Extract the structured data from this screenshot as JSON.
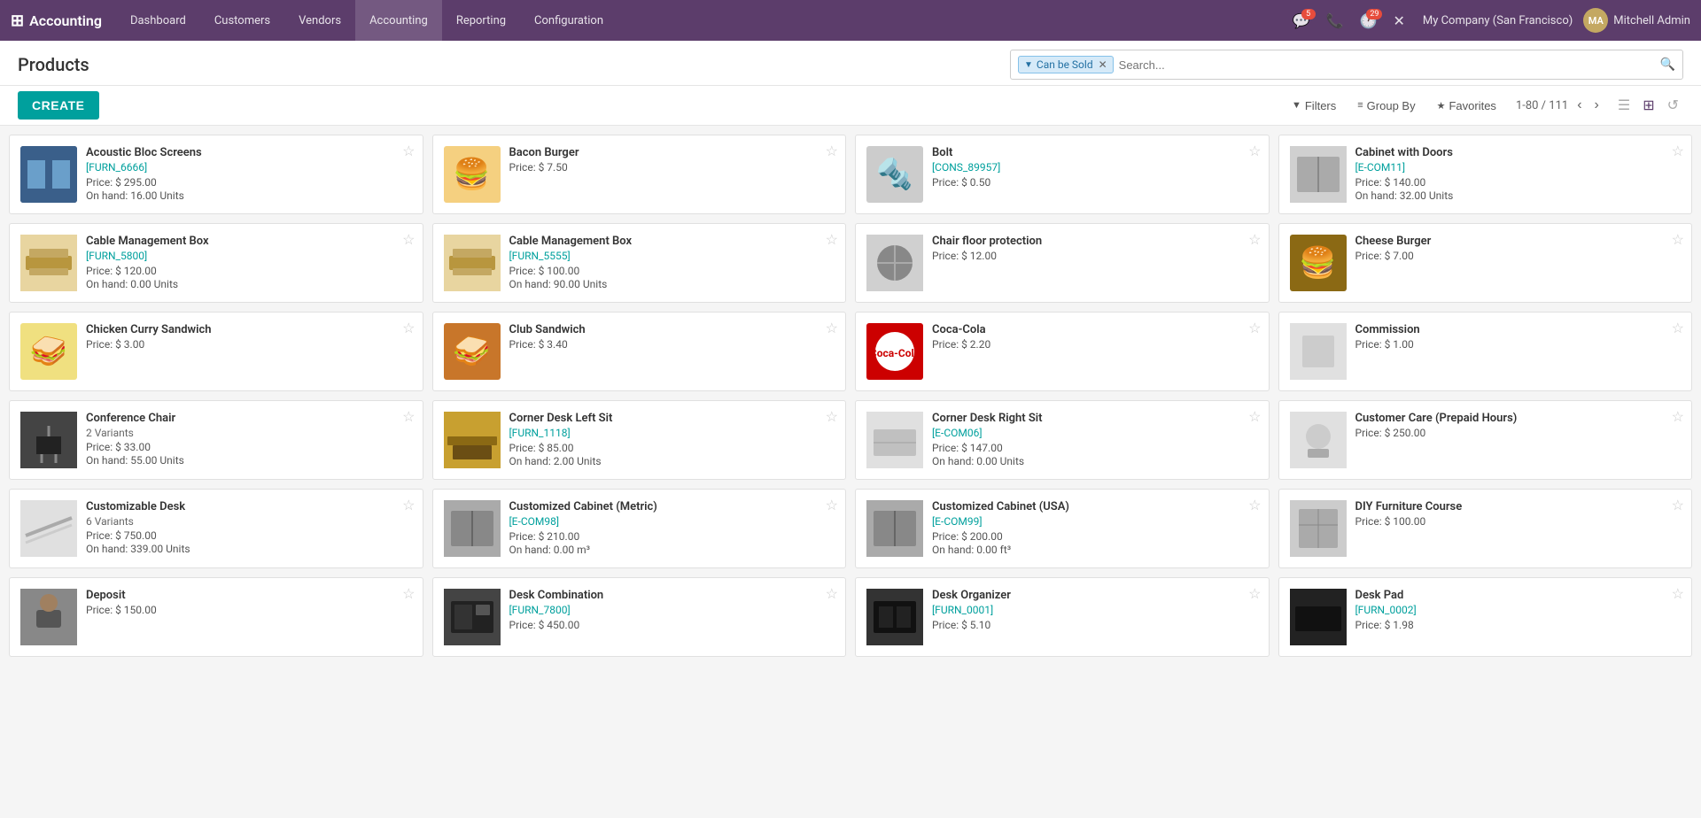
{
  "app": {
    "name": "Accounting"
  },
  "topnav": {
    "menu_items": [
      {
        "label": "Dashboard",
        "active": false
      },
      {
        "label": "Customers",
        "active": false
      },
      {
        "label": "Vendors",
        "active": false
      },
      {
        "label": "Accounting",
        "active": true
      },
      {
        "label": "Reporting",
        "active": false
      },
      {
        "label": "Configuration",
        "active": false
      }
    ],
    "icons": [
      {
        "name": "chat-icon",
        "symbol": "💬",
        "badge": "5"
      },
      {
        "name": "phone-icon",
        "symbol": "📞",
        "badge": null
      },
      {
        "name": "clock-icon",
        "symbol": "🕐",
        "badge": "29"
      },
      {
        "name": "close-icon",
        "symbol": "✕",
        "badge": null
      }
    ],
    "company": "My Company (San Francisco)",
    "user": "Mitchell Admin"
  },
  "page": {
    "title": "Products",
    "create_label": "CREATE"
  },
  "search": {
    "filter_tag": "Can be Sold",
    "placeholder": "Search..."
  },
  "toolbar": {
    "filters_label": "Filters",
    "groupby_label": "Group By",
    "favorites_label": "Favorites",
    "pagination": "1-80 / 111"
  },
  "products": [
    {
      "name": "Acoustic Bloc Screens",
      "ref": "[FURN_6666]",
      "price": "Price: $ 295.00",
      "onhand": "On hand: 16.00 Units",
      "variants": null,
      "emoji": "🪟",
      "color": "#3a5f8a"
    },
    {
      "name": "Bacon Burger",
      "ref": null,
      "price": "Price: $ 7.50",
      "onhand": null,
      "variants": null,
      "emoji": "🍔",
      "color": "#c87941"
    },
    {
      "name": "Bolt",
      "ref": "[CONS_89957]",
      "price": "Price: $ 0.50",
      "onhand": null,
      "variants": null,
      "emoji": "🔩",
      "color": "#888"
    },
    {
      "name": "Cabinet with Doors",
      "ref": "[E-COM11]",
      "price": "Price: $ 140.00",
      "onhand": "On hand: 32.00 Units",
      "variants": null,
      "emoji": "🗄️",
      "color": "#888"
    },
    {
      "name": "Cable Management Box",
      "ref": "[FURN_5800]",
      "price": "Price: $ 120.00",
      "onhand": "On hand: 0.00 Units",
      "variants": null,
      "emoji": "📦",
      "color": "#c4a862"
    },
    {
      "name": "Cable Management Box",
      "ref": "[FURN_5555]",
      "price": "Price: $ 100.00",
      "onhand": "On hand: 90.00 Units",
      "variants": null,
      "emoji": "📦",
      "color": "#c4a862"
    },
    {
      "name": "Chair floor protection",
      "ref": null,
      "price": "Price: $ 12.00",
      "onhand": null,
      "variants": null,
      "emoji": "🪑",
      "color": "#555"
    },
    {
      "name": "Cheese Burger",
      "ref": null,
      "price": "Price: $ 7.00",
      "onhand": null,
      "variants": null,
      "emoji": "🍔",
      "color": "#b87333"
    },
    {
      "name": "Chicken Curry Sandwich",
      "ref": null,
      "price": "Price: $ 3.00",
      "onhand": null,
      "variants": null,
      "emoji": "🥪",
      "color": "#c8a030"
    },
    {
      "name": "Club Sandwich",
      "ref": null,
      "price": "Price: $ 3.40",
      "onhand": null,
      "variants": null,
      "emoji": "🥪",
      "color": "#b87030"
    },
    {
      "name": "Coca-Cola",
      "ref": null,
      "price": "Price: $ 2.20",
      "onhand": null,
      "variants": null,
      "emoji": "🥤",
      "color": "#cc0000"
    },
    {
      "name": "Commission",
      "ref": null,
      "price": "Price: $ 1.00",
      "onhand": null,
      "variants": null,
      "emoji": "📄",
      "color": "#aaa"
    },
    {
      "name": "Conference Chair",
      "ref": null,
      "price": "Price: $ 33.00",
      "onhand": "On hand: 55.00 Units",
      "variants": "2 Variants",
      "emoji": "🪑",
      "color": "#333"
    },
    {
      "name": "Corner Desk Left Sit",
      "ref": "[FURN_1118]",
      "price": "Price: $ 85.00",
      "onhand": "On hand: 2.00 Units",
      "variants": null,
      "emoji": "🪑",
      "color": "#8b6914"
    },
    {
      "name": "Corner Desk Right Sit",
      "ref": "[E-COM06]",
      "price": "Price: $ 147.00",
      "onhand": "On hand: 0.00 Units",
      "variants": null,
      "emoji": "🖥️",
      "color": "#888"
    },
    {
      "name": "Customer Care (Prepaid Hours)",
      "ref": null,
      "price": "Price: $ 250.00",
      "onhand": null,
      "variants": null,
      "emoji": "🎧",
      "color": "#aaa"
    },
    {
      "name": "Customizable Desk",
      "ref": null,
      "price": "Price: $ 750.00",
      "onhand": "On hand: 339.00 Units",
      "variants": "6 Variants",
      "emoji": "🖥️",
      "color": "#888"
    },
    {
      "name": "Customized Cabinet (Metric)",
      "ref": "[E-COM98]",
      "price": "Price: $ 210.00",
      "onhand": "On hand: 0.00 m³",
      "variants": null,
      "emoji": "🗄️",
      "color": "#777"
    },
    {
      "name": "Customized Cabinet (USA)",
      "ref": "[E-COM99]",
      "price": "Price: $ 200.00",
      "onhand": "On hand: 0.00 ft³",
      "variants": null,
      "emoji": "🗄️",
      "color": "#777"
    },
    {
      "name": "DIY Furniture Course",
      "ref": null,
      "price": "Price: $ 100.00",
      "onhand": null,
      "variants": null,
      "emoji": "📚",
      "color": "#888"
    },
    {
      "name": "Deposit",
      "ref": null,
      "price": "Price: $ 150.00",
      "onhand": null,
      "variants": null,
      "emoji": "💳",
      "color": "#555"
    },
    {
      "name": "Desk Combination",
      "ref": "[FURN_7800]",
      "price": "Price: $ 450.00",
      "onhand": null,
      "variants": null,
      "emoji": "🖥️",
      "color": "#444"
    },
    {
      "name": "Desk Organizer",
      "ref": "[FURN_0001]",
      "price": "Price: $ 5.10",
      "onhand": null,
      "variants": null,
      "emoji": "🖊️",
      "color": "#333"
    },
    {
      "name": "Desk Pad",
      "ref": "[FURN_0002]",
      "price": "Price: $ 1.98",
      "onhand": null,
      "variants": null,
      "emoji": "📋",
      "color": "#222"
    }
  ]
}
